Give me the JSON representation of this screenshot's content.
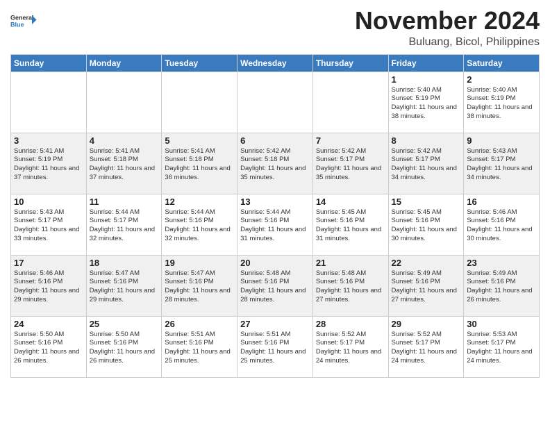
{
  "header": {
    "logo_line1": "General",
    "logo_line2": "Blue",
    "month": "November 2024",
    "location": "Buluang, Bicol, Philippines"
  },
  "weekdays": [
    "Sunday",
    "Monday",
    "Tuesday",
    "Wednesday",
    "Thursday",
    "Friday",
    "Saturday"
  ],
  "weeks": [
    [
      {
        "day": "",
        "sunrise": "",
        "sunset": "",
        "daylight": ""
      },
      {
        "day": "",
        "sunrise": "",
        "sunset": "",
        "daylight": ""
      },
      {
        "day": "",
        "sunrise": "",
        "sunset": "",
        "daylight": ""
      },
      {
        "day": "",
        "sunrise": "",
        "sunset": "",
        "daylight": ""
      },
      {
        "day": "",
        "sunrise": "",
        "sunset": "",
        "daylight": ""
      },
      {
        "day": "1",
        "sunrise": "Sunrise: 5:40 AM",
        "sunset": "Sunset: 5:19 PM",
        "daylight": "Daylight: 11 hours and 38 minutes."
      },
      {
        "day": "2",
        "sunrise": "Sunrise: 5:40 AM",
        "sunset": "Sunset: 5:19 PM",
        "daylight": "Daylight: 11 hours and 38 minutes."
      }
    ],
    [
      {
        "day": "3",
        "sunrise": "Sunrise: 5:41 AM",
        "sunset": "Sunset: 5:19 PM",
        "daylight": "Daylight: 11 hours and 37 minutes."
      },
      {
        "day": "4",
        "sunrise": "Sunrise: 5:41 AM",
        "sunset": "Sunset: 5:18 PM",
        "daylight": "Daylight: 11 hours and 37 minutes."
      },
      {
        "day": "5",
        "sunrise": "Sunrise: 5:41 AM",
        "sunset": "Sunset: 5:18 PM",
        "daylight": "Daylight: 11 hours and 36 minutes."
      },
      {
        "day": "6",
        "sunrise": "Sunrise: 5:42 AM",
        "sunset": "Sunset: 5:18 PM",
        "daylight": "Daylight: 11 hours and 35 minutes."
      },
      {
        "day": "7",
        "sunrise": "Sunrise: 5:42 AM",
        "sunset": "Sunset: 5:17 PM",
        "daylight": "Daylight: 11 hours and 35 minutes."
      },
      {
        "day": "8",
        "sunrise": "Sunrise: 5:42 AM",
        "sunset": "Sunset: 5:17 PM",
        "daylight": "Daylight: 11 hours and 34 minutes."
      },
      {
        "day": "9",
        "sunrise": "Sunrise: 5:43 AM",
        "sunset": "Sunset: 5:17 PM",
        "daylight": "Daylight: 11 hours and 34 minutes."
      }
    ],
    [
      {
        "day": "10",
        "sunrise": "Sunrise: 5:43 AM",
        "sunset": "Sunset: 5:17 PM",
        "daylight": "Daylight: 11 hours and 33 minutes."
      },
      {
        "day": "11",
        "sunrise": "Sunrise: 5:44 AM",
        "sunset": "Sunset: 5:17 PM",
        "daylight": "Daylight: 11 hours and 32 minutes."
      },
      {
        "day": "12",
        "sunrise": "Sunrise: 5:44 AM",
        "sunset": "Sunset: 5:16 PM",
        "daylight": "Daylight: 11 hours and 32 minutes."
      },
      {
        "day": "13",
        "sunrise": "Sunrise: 5:44 AM",
        "sunset": "Sunset: 5:16 PM",
        "daylight": "Daylight: 11 hours and 31 minutes."
      },
      {
        "day": "14",
        "sunrise": "Sunrise: 5:45 AM",
        "sunset": "Sunset: 5:16 PM",
        "daylight": "Daylight: 11 hours and 31 minutes."
      },
      {
        "day": "15",
        "sunrise": "Sunrise: 5:45 AM",
        "sunset": "Sunset: 5:16 PM",
        "daylight": "Daylight: 11 hours and 30 minutes."
      },
      {
        "day": "16",
        "sunrise": "Sunrise: 5:46 AM",
        "sunset": "Sunset: 5:16 PM",
        "daylight": "Daylight: 11 hours and 30 minutes."
      }
    ],
    [
      {
        "day": "17",
        "sunrise": "Sunrise: 5:46 AM",
        "sunset": "Sunset: 5:16 PM",
        "daylight": "Daylight: 11 hours and 29 minutes."
      },
      {
        "day": "18",
        "sunrise": "Sunrise: 5:47 AM",
        "sunset": "Sunset: 5:16 PM",
        "daylight": "Daylight: 11 hours and 29 minutes."
      },
      {
        "day": "19",
        "sunrise": "Sunrise: 5:47 AM",
        "sunset": "Sunset: 5:16 PM",
        "daylight": "Daylight: 11 hours and 28 minutes."
      },
      {
        "day": "20",
        "sunrise": "Sunrise: 5:48 AM",
        "sunset": "Sunset: 5:16 PM",
        "daylight": "Daylight: 11 hours and 28 minutes."
      },
      {
        "day": "21",
        "sunrise": "Sunrise: 5:48 AM",
        "sunset": "Sunset: 5:16 PM",
        "daylight": "Daylight: 11 hours and 27 minutes."
      },
      {
        "day": "22",
        "sunrise": "Sunrise: 5:49 AM",
        "sunset": "Sunset: 5:16 PM",
        "daylight": "Daylight: 11 hours and 27 minutes."
      },
      {
        "day": "23",
        "sunrise": "Sunrise: 5:49 AM",
        "sunset": "Sunset: 5:16 PM",
        "daylight": "Daylight: 11 hours and 26 minutes."
      }
    ],
    [
      {
        "day": "24",
        "sunrise": "Sunrise: 5:50 AM",
        "sunset": "Sunset: 5:16 PM",
        "daylight": "Daylight: 11 hours and 26 minutes."
      },
      {
        "day": "25",
        "sunrise": "Sunrise: 5:50 AM",
        "sunset": "Sunset: 5:16 PM",
        "daylight": "Daylight: 11 hours and 26 minutes."
      },
      {
        "day": "26",
        "sunrise": "Sunrise: 5:51 AM",
        "sunset": "Sunset: 5:16 PM",
        "daylight": "Daylight: 11 hours and 25 minutes."
      },
      {
        "day": "27",
        "sunrise": "Sunrise: 5:51 AM",
        "sunset": "Sunset: 5:16 PM",
        "daylight": "Daylight: 11 hours and 25 minutes."
      },
      {
        "day": "28",
        "sunrise": "Sunrise: 5:52 AM",
        "sunset": "Sunset: 5:17 PM",
        "daylight": "Daylight: 11 hours and 24 minutes."
      },
      {
        "day": "29",
        "sunrise": "Sunrise: 5:52 AM",
        "sunset": "Sunset: 5:17 PM",
        "daylight": "Daylight: 11 hours and 24 minutes."
      },
      {
        "day": "30",
        "sunrise": "Sunrise: 5:53 AM",
        "sunset": "Sunset: 5:17 PM",
        "daylight": "Daylight: 11 hours and 24 minutes."
      }
    ]
  ],
  "row_styles": [
    "row-white",
    "row-shaded",
    "row-white",
    "row-shaded",
    "row-white"
  ]
}
